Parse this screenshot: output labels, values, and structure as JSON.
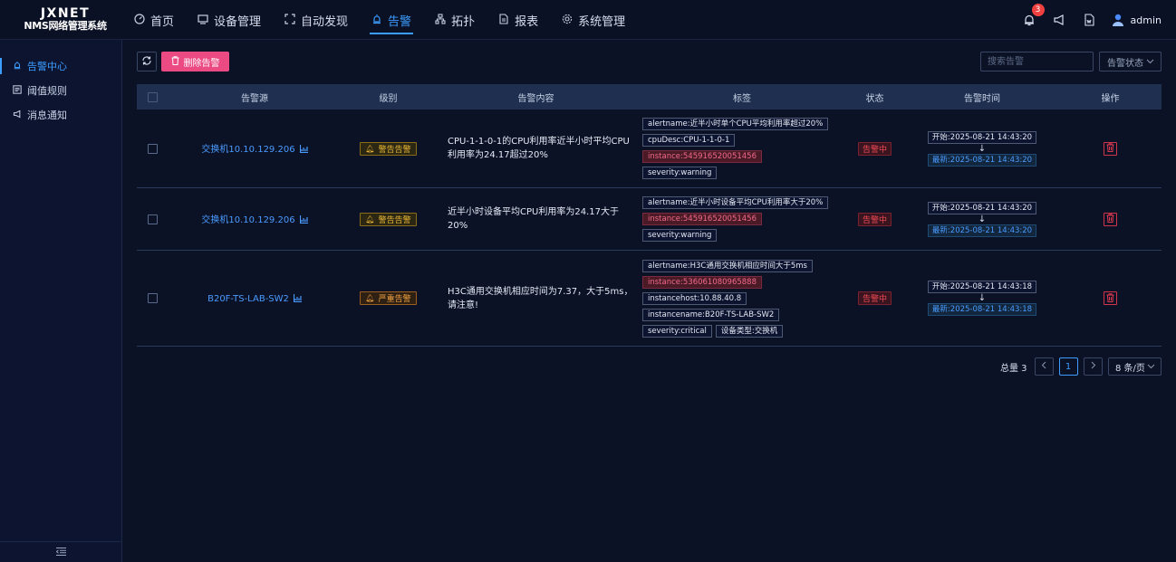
{
  "logo": {
    "line1": "JXNET",
    "line2": "NMS网络管理系统"
  },
  "nav": [
    {
      "label": "首页",
      "icon": "dashboard-icon",
      "active": false
    },
    {
      "label": "设备管理",
      "icon": "monitor-icon",
      "active": false
    },
    {
      "label": "自动发现",
      "icon": "scan-icon",
      "active": false
    },
    {
      "label": "告警",
      "icon": "alarm-icon",
      "active": true
    },
    {
      "label": "拓扑",
      "icon": "topology-icon",
      "active": false
    },
    {
      "label": "报表",
      "icon": "report-icon",
      "active": false
    },
    {
      "label": "系统管理",
      "icon": "gear-icon",
      "active": false
    }
  ],
  "topright": {
    "notification_count": "3",
    "user": "admin"
  },
  "sidebar": {
    "items": [
      {
        "label": "告警中心",
        "icon": "alarm-icon",
        "active": true
      },
      {
        "label": "阈值规则",
        "icon": "rules-icon",
        "active": false
      },
      {
        "label": "消息通知",
        "icon": "megaphone-icon",
        "active": false
      }
    ]
  },
  "toolbar": {
    "delete_label": "删除告警",
    "search_placeholder": "搜索告警",
    "status_select": "告警状态"
  },
  "table": {
    "headers": {
      "source": "告警源",
      "level": "级别",
      "content": "告警内容",
      "tags": "标签",
      "state": "状态",
      "time": "告警时间",
      "op": "操作"
    },
    "rows": [
      {
        "source": "交换机10.10.129.206",
        "level": "警告告警",
        "content": "CPU-1-1-0-1的CPU利用率近半小时平均CPU利用率为24.17超过20%",
        "tags": [
          {
            "text": "alertname:近半小时单个CPU平均利用率超过20%",
            "red": false
          },
          {
            "text": "cpuDesc:CPU-1-1-0-1",
            "red": false
          },
          {
            "text": "instance:545916520051456",
            "red": true
          },
          {
            "text": "severity:warning",
            "red": false
          }
        ],
        "state": "告警中",
        "start": "开始:2025-08-21 14:43:20",
        "latest": "最新:2025-08-21 14:43:20"
      },
      {
        "source": "交换机10.10.129.206",
        "level": "警告告警",
        "content": "近半小时设备平均CPU利用率为24.17大于20%",
        "tags": [
          {
            "text": "alertname:近半小时设备平均CPU利用率大于20%",
            "red": false
          },
          {
            "text": "instance:545916520051456",
            "red": true
          },
          {
            "text": "severity:warning",
            "red": false
          }
        ],
        "state": "告警中",
        "start": "开始:2025-08-21 14:43:20",
        "latest": "最新:2025-08-21 14:43:20"
      },
      {
        "source": "B20F-TS-LAB-SW2",
        "level": "严重告警",
        "content": "H3C通用交换机相应时间为7.37，大于5ms，请注意!",
        "tags": [
          {
            "text": "alertname:H3C通用交换机相应时间大于5ms",
            "red": false
          },
          {
            "text": "instance:536061080965888",
            "red": true
          },
          {
            "text": "instancehost:10.88.40.8",
            "red": false
          },
          {
            "text": "instancename:B20F-TS-LAB-SW2",
            "red": false
          },
          {
            "text": "severity:critical",
            "red": false
          },
          {
            "text": "设备类型:交换机",
            "red": false
          }
        ],
        "state": "告警中",
        "start": "开始:2025-08-21 14:43:18",
        "latest": "最新:2025-08-21 14:43:18"
      }
    ]
  },
  "pagination": {
    "total": "总量 3",
    "page": "1",
    "page_size": "8 条/页"
  }
}
